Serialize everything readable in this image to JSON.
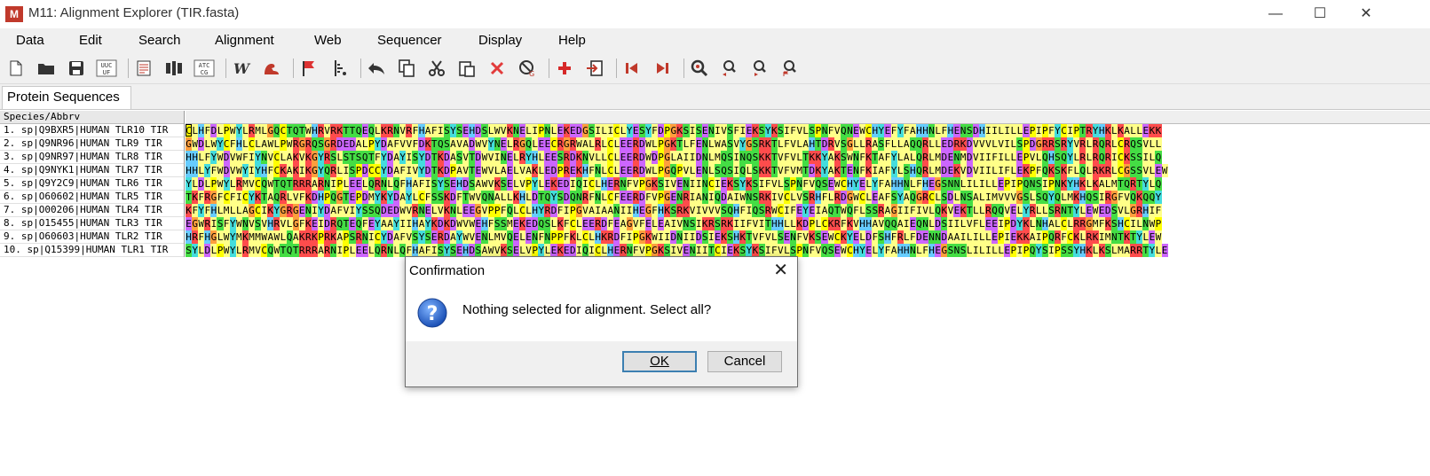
{
  "window": {
    "title": "M11: Alignment Explorer (TIR.fasta)",
    "app_icon": "M",
    "minimize": "—",
    "maximize": "☐",
    "close": "✕"
  },
  "menu": [
    "Data",
    "Edit",
    "Search",
    "Alignment",
    "Web",
    "Sequencer",
    "Display",
    "Help"
  ],
  "toolbar": [
    {
      "name": "new-file-icon",
      "glyph": "doc"
    },
    {
      "name": "open-folder-icon",
      "glyph": "folder"
    },
    {
      "name": "save-icon",
      "glyph": "save"
    },
    {
      "name": "uucf-icon",
      "glyph": "text",
      "label": "UUC\nUF"
    },
    {
      "name": "sep"
    },
    {
      "name": "view-list-icon",
      "glyph": "list"
    },
    {
      "name": "columns-icon",
      "glyph": "cols"
    },
    {
      "name": "atcg-icon",
      "glyph": "text",
      "label": "ATC\nCG"
    },
    {
      "name": "sep"
    },
    {
      "name": "w-icon",
      "glyph": "w"
    },
    {
      "name": "muscle-icon",
      "glyph": "arm"
    },
    {
      "name": "sep"
    },
    {
      "name": "flag-icon",
      "glyph": "flag"
    },
    {
      "name": "marker-icon",
      "glyph": "marker"
    },
    {
      "name": "sep"
    },
    {
      "name": "undo-icon",
      "glyph": "undo"
    },
    {
      "name": "copy-icon",
      "glyph": "copy"
    },
    {
      "name": "cut-icon",
      "glyph": "cut"
    },
    {
      "name": "paste-icon",
      "glyph": "paste"
    },
    {
      "name": "delete-icon",
      "glyph": "x"
    },
    {
      "name": "delete-gap-icon",
      "glyph": "nogap"
    },
    {
      "name": "sep"
    },
    {
      "name": "add-sequence-icon",
      "glyph": "plus"
    },
    {
      "name": "import-icon",
      "glyph": "import"
    },
    {
      "name": "sep"
    },
    {
      "name": "prev-block-icon",
      "glyph": "prev"
    },
    {
      "name": "next-block-icon",
      "glyph": "next"
    },
    {
      "name": "sep"
    },
    {
      "name": "find-icon",
      "glyph": "find"
    },
    {
      "name": "find-prev-icon",
      "glyph": "findprev"
    },
    {
      "name": "find-next-icon",
      "glyph": "findnext"
    },
    {
      "name": "find-marker-icon",
      "glyph": "findmark"
    }
  ],
  "tab": {
    "label": "Protein Sequences"
  },
  "grid": {
    "header": "Species/Abbrv",
    "rows": [
      {
        "name": "1. sp|Q9BXR5|HUMAN TLR10 TIR",
        "seq": "CLHFDLPWYLRMLGQCTQTWHRVRKTTQEQLKRNVRFHAFISYSEHDSLWVKNELIPNLEKEDGSILICLYESYFDPGKSISENIVSFIEKSYKSIFVLSPNFVQNEWCHYEFYFAHHNLFHENSDHIILILLEPIPFYCIPTRYHKLKALLEKK"
      },
      {
        "name": "2. sp|Q9NR96|HUMAN TLR9 TIR",
        "seq": "GWDLWYCFHLCLAWLPWRGRQSGRDEDALPYDAFVVFDKTQSAVADWVYNELRGQLEECRGRWALRLCLEERDWLPGKTLFENLWASVYGSRKTLFVLAHTDRVSGLLRASFLLAQQRLLEDRKDVVVLVILSPDGRRSRYVRLRQRLCRQSVLL"
      },
      {
        "name": "3. sp|Q9NR97|HUMAN TLR8 TIR",
        "seq": "HHLFYWDVWFIYNVCLAKVKGYRSLSTSQTFYDAYISYDTKDASVTDWVINELRYHLEESRDKNVLLCLEERDWDPGLAIIDNLMQSINQSKKTVFVLTKKYAKSWNFKTAFYLALQRLMDENMDVIIFILLEPVLQHSQYLRLRQRICKSSILQ"
      },
      {
        "name": "4. sp|Q9NYK1|HUMAN TLR7 TIR",
        "seq": "HHLYFWDVWYIYHFCKAKIKGYQRLISPDCCYDAFIVYDTKDPAVTEWVLAELVAKLEDPREKHFNLCLEERDWLPGQPVLENLSQSIQLSKKTVFVMTDKYAKTENFKIAFYLSHQRLMDEKVDVIILIFLEKPFQKSKFLQLRKRLCGSSVLEW"
      },
      {
        "name": "5. sp|Q9Y2C9|HUMAN TLR6 TIR",
        "seq": "YLDLPWYLRMVCQWTQTRRRARNIPLEELQRNLQFHAFISYSEHDSAWVKSELVPYLEKEDIQICLHERNFVPGKSIVENIINCIEKSYKSIFVLSPNFVQSEWCHYELYFAHHNLFHEGSNNLILILLEPIPQNSIPNKYHKLKALMTQRTYLQ"
      },
      {
        "name": "6. sp|O60602|HUMAN TLR5 TIR",
        "seq": "TKFRGFCFICYKTAQRLVFKDHPQGTEPDMYKYDAYLCFSSKDFTWVQNALLKHLDTQYSDQNRFNLCFEERDFVPGENRIANIQDAIWNSRKIVCLVSRHFLRDGWCLEAFSYAQGRCLSDLNSALIMVVVGSLSQYQLMKHQSIRGFVQKQQY"
      },
      {
        "name": "7. sp|O00206|HUMAN TLR4 TIR",
        "seq": "KFYFHLMLLAGCIKYGRGENIYDAFVIYSSQDEDWVRNELVKNLEEGVPPFQLCLHYRDFIPGVAIAANIIHEGFHKSRKVIVVVSQHFIQSRWCIFEYEIAQTWQFLSSRAGIIFIVLQKVEKTLLRQQVELYRLLSRNTYLEWEDSVLGRHIF"
      },
      {
        "name": "8. sp|O15455|HUMAN TLR3 TIR",
        "seq": "EGWRISFYWNVSVHRVLGFKEIDRQTEQFEYAAYIIHAYKDKDWVWEHFSSMEKEDQSLKFCLEERDFEAGVFELEAIVNSIKRSRKIIFVITHHLLKDPLCKRFKVHHAVQQAIEQNLDSIILVFLEEIPDYKLNHALCLRRGMFKSHCILNWP"
      },
      {
        "name": "9. sp|O60603|HUMAN TLR2 TIR",
        "seq": "HRFHGLWYMKMMWAWLQAKRKPRKAPSRNICYDAFVSYSERDAYWVENLMVQELENFNPPFKLCLHKRDFIPGKWIIDNIIDSIEKSHKTVFVLSENFVKSEWCKYELDFSHFRLFDENNDAAILILLEPIEKKAIPQRFCKLRKIMNTKTYLEW"
      },
      {
        "name": "10. sp|Q15399|HUMAN TLR1 TIR",
        "seq": "SYLDLPWYLRMVCQWTQTRRRARNIPLEELQRNLQFHAFISYSEHDSAWVKSELVPYLEKEDIQICLHERNFVPGKSIVENIITCIEKSYKSIFVLSPNFVQSEWCHYELYFAHHNLFHEGSNSLILILLEPIPQYSIPSSYHKLKSLMARRTYLE"
      }
    ]
  },
  "colors": {
    "A": "#ffff88",
    "V": "#ffff88",
    "L": "#ffff88",
    "I": "#ffff88",
    "M": "#ffff88",
    "F": "#ffff88",
    "W": "#ffff88",
    "G": "#ff9e3d",
    "P": "#ffff00",
    "C": "#ffff00",
    "S": "#44dd44",
    "T": "#44dd44",
    "N": "#44dd44",
    "Q": "#44dd44",
    "K": "#ff4c4c",
    "R": "#ff4c4c",
    "H": "#66ccff",
    "D": "#cc66ff",
    "E": "#cc66ff",
    "Y": "#44dddd"
  },
  "dialog": {
    "title": "Confirmation",
    "message": "Nothing selected for alignment. Select all?",
    "ok": "OK",
    "cancel": "Cancel",
    "icon": "question-icon"
  }
}
